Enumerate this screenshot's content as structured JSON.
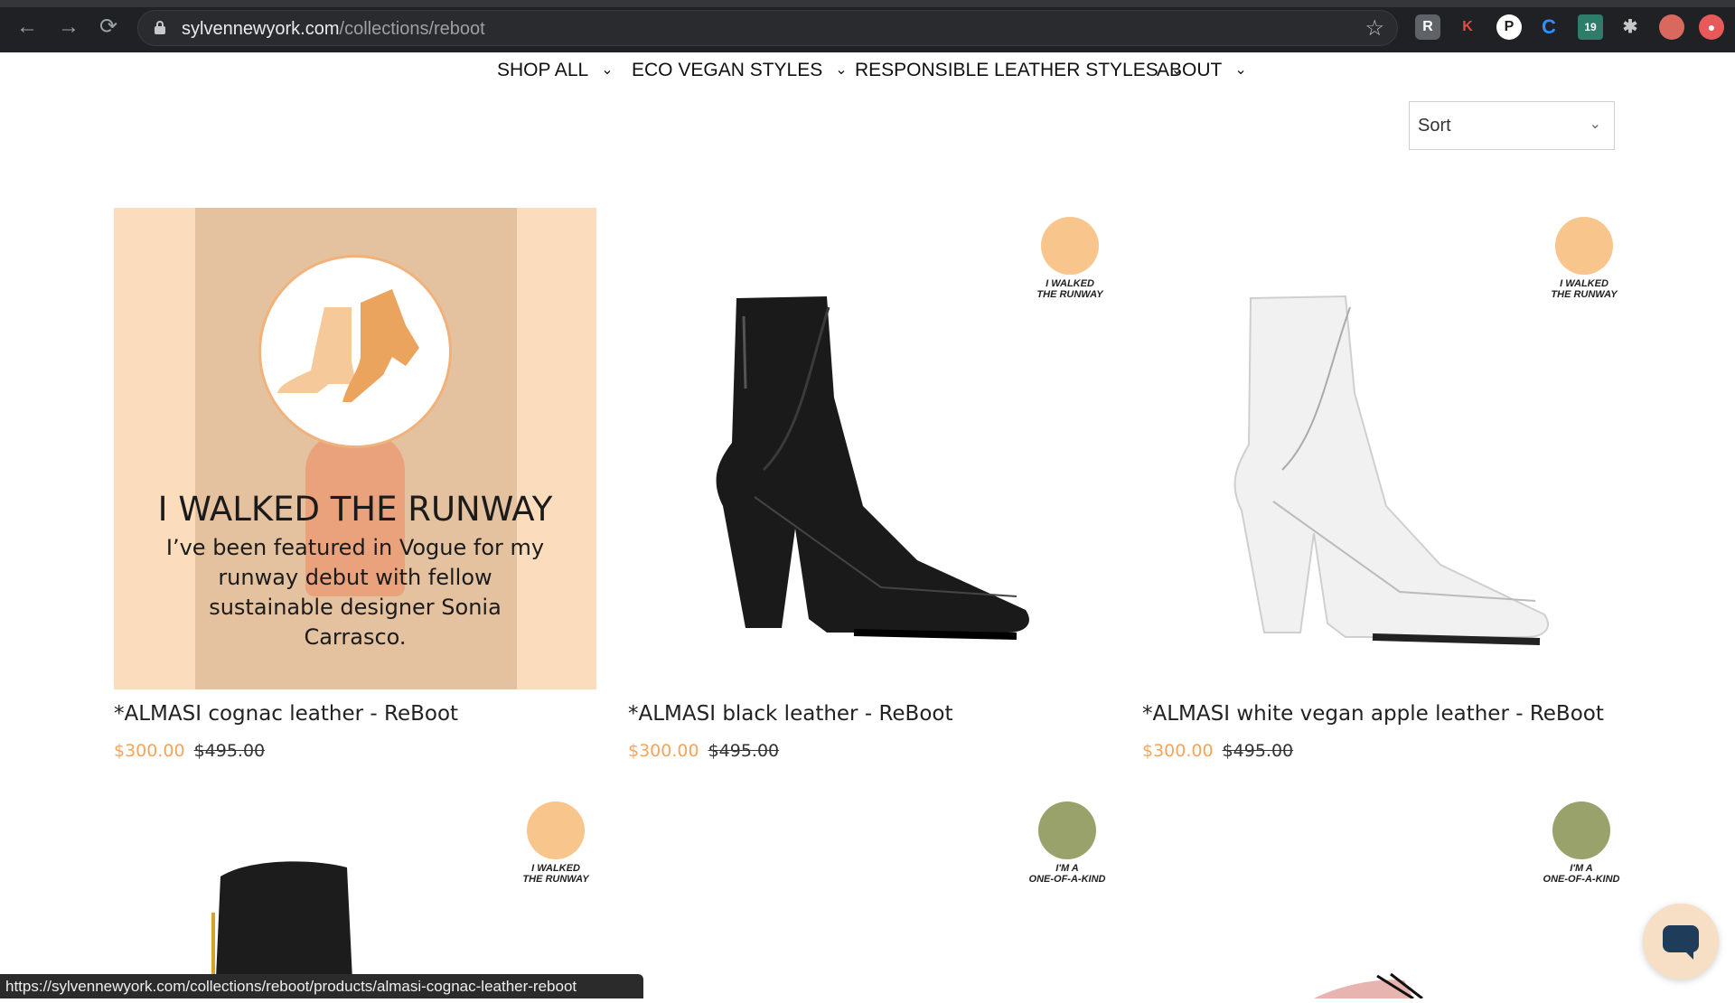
{
  "browser": {
    "url_host": "sylvennewyork.com",
    "url_path": "/collections/reboot",
    "status_url": "https://sylvennewyork.com/collections/reboot/products/almasi-cognac-leather-reboot",
    "extensions": [
      {
        "name": "extension-r",
        "glyph": "R",
        "color": "#8a8a8a"
      },
      {
        "name": "extension-k",
        "glyph": "K",
        "color": "#e54a4a"
      },
      {
        "name": "pinterest",
        "glyph": "P",
        "color": "#ffffff"
      },
      {
        "name": "extension-c",
        "glyph": "C",
        "color": "#2f8fff"
      },
      {
        "name": "calendar",
        "glyph": "19",
        "color": "#2e7d6a"
      },
      {
        "name": "puzzle",
        "glyph": "✱",
        "color": "#c8c8c8"
      },
      {
        "name": "profile",
        "glyph": "",
        "color": "#d9695f"
      },
      {
        "name": "extension-red",
        "glyph": "●",
        "color": "#e85a5a"
      }
    ]
  },
  "nav": {
    "items": [
      {
        "label": "SHOP ALL"
      },
      {
        "label": "ECO VEGAN STYLES"
      },
      {
        "label": "RESPONSIBLE LEATHER STYLES"
      },
      {
        "label": "ABOUT"
      }
    ]
  },
  "sort": {
    "label": "Sort"
  },
  "promo": {
    "title": "I WALKED THE RUNWAY",
    "description": "I’ve been featured in Vogue for my runway debut with fellow sustainable designer Sonia Carrasco."
  },
  "badges": {
    "runway": "I WALKED\nTHE RUNWAY",
    "one_of_a_kind": "I'M A\nONE-OF-A-KIND"
  },
  "products": [
    {
      "title": "*ALMASI cognac leather - ReBoot",
      "sale_price": "$300.00",
      "original_price": "$495.00"
    },
    {
      "title": "*ALMASI black leather - ReBoot",
      "sale_price": "$300.00",
      "original_price": "$495.00"
    },
    {
      "title": "*ALMASI white vegan apple leather - ReBoot",
      "sale_price": "$300.00",
      "original_price": "$495.00"
    }
  ],
  "colors": {
    "accent_price": "#f2a55c",
    "badge_runway": "#f8c58d",
    "badge_one_of_a_kind": "#9aa26b",
    "chat_icon": "#1f3d5b"
  }
}
